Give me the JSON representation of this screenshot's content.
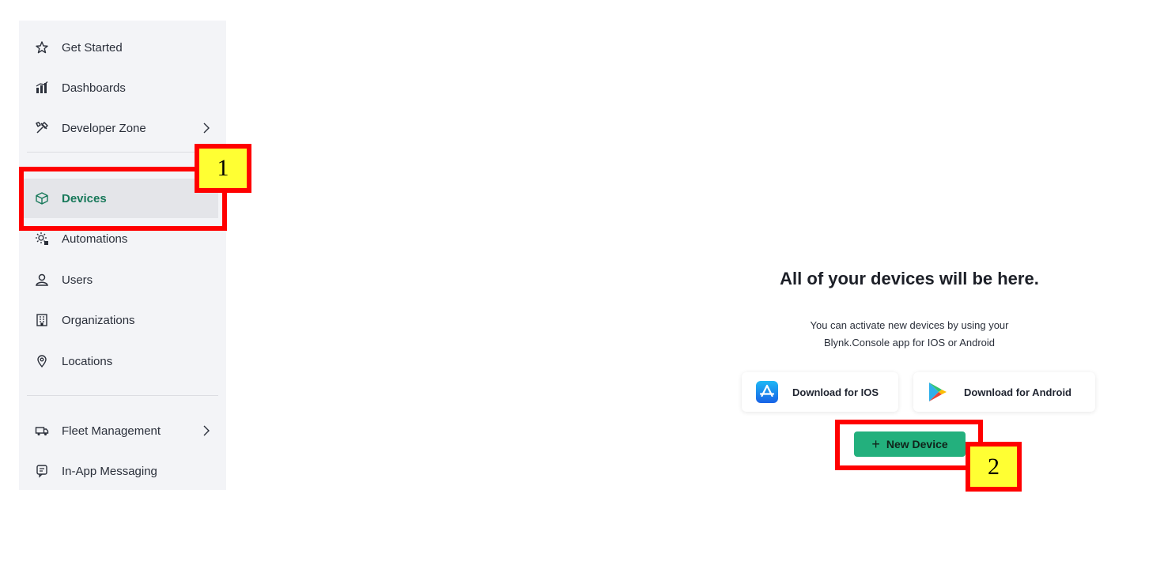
{
  "sidebar": {
    "items": [
      {
        "label": "Get Started",
        "icon": "star-icon"
      },
      {
        "label": "Dashboards",
        "icon": "dashboards-icon"
      },
      {
        "label": "Developer Zone",
        "icon": "tools-icon",
        "has_chevron": true
      },
      {
        "label": "Devices",
        "icon": "cube-icon",
        "active": true
      },
      {
        "label": "Automations",
        "icon": "automations-icon"
      },
      {
        "label": "Users",
        "icon": "users-icon"
      },
      {
        "label": "Organizations",
        "icon": "building-icon"
      },
      {
        "label": "Locations",
        "icon": "location-pin-icon"
      },
      {
        "label": "Fleet Management",
        "icon": "truck-icon",
        "has_chevron": true
      },
      {
        "label": "In-App Messaging",
        "icon": "messaging-icon"
      }
    ],
    "active_color": "#18795a"
  },
  "annotations": {
    "label_1": "1",
    "label_2": "2",
    "color": "#ff0000",
    "label_bg": "#ffff33"
  },
  "main": {
    "empty_title": "All of your devices will be here.",
    "empty_desc_line1": "You can activate new devices by using your",
    "empty_desc_line2": "Blynk.Console app for IOS or Android",
    "ios_button": "Download for IOS",
    "android_button": "Download for Android",
    "new_device_button": "New Device",
    "new_device_color": "#23b07d"
  }
}
